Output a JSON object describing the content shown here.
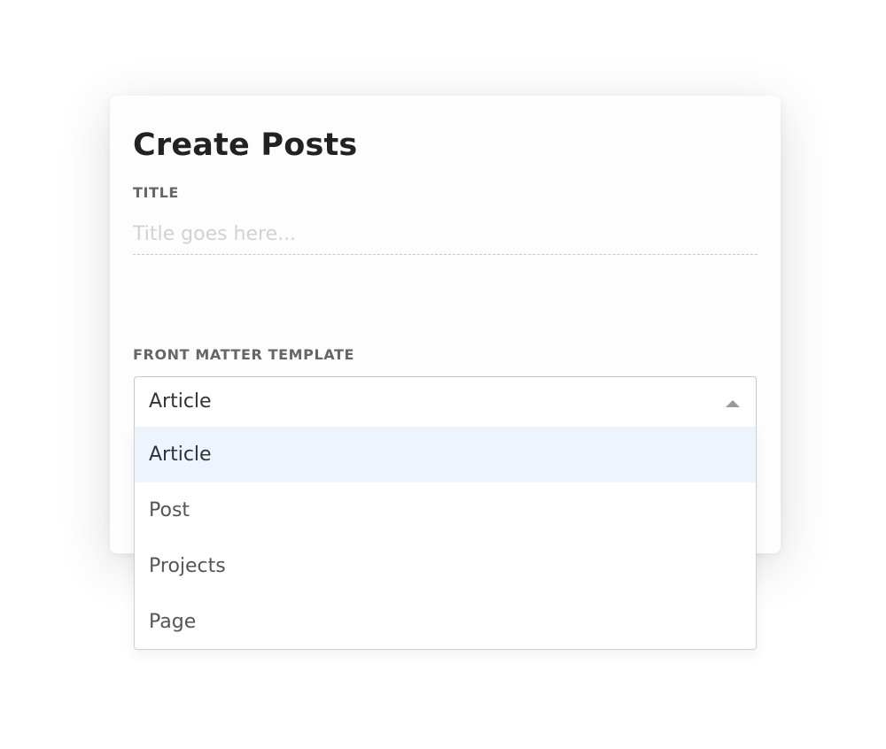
{
  "dialog": {
    "title": "Create Posts"
  },
  "title_field": {
    "label": "TITLE",
    "value": "",
    "placeholder": "Title goes here..."
  },
  "template_field": {
    "label": "FRONT MATTER TEMPLATE",
    "selected": "Article",
    "options": [
      {
        "label": "Article",
        "selected": true
      },
      {
        "label": "Post",
        "selected": false
      },
      {
        "label": "Projects",
        "selected": false
      },
      {
        "label": "Page",
        "selected": false
      }
    ]
  },
  "colors": {
    "option_highlight": "#edf4fd",
    "title_text": "#222222",
    "label_text": "#666666",
    "placeholder_text": "#d2d2d2"
  },
  "icons": {
    "dropdown_caret": "caret-up-icon"
  }
}
